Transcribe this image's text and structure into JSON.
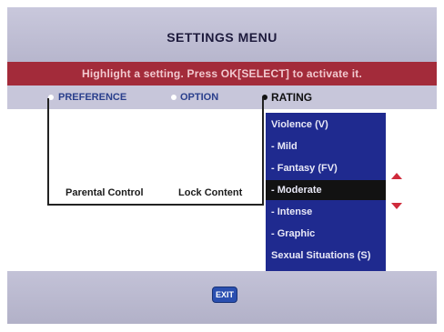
{
  "title": "SETTINGS MENU",
  "banner": "Highlight a setting. Press OK[SELECT] to activate it.",
  "tabs": [
    {
      "label": "PREFERENCE"
    },
    {
      "label": "OPTION"
    },
    {
      "label": "RATING"
    }
  ],
  "labels": {
    "parental": "Parental Control",
    "lock": "Lock Content"
  },
  "rating_list": [
    {
      "label": "Violence (V)",
      "selected": false
    },
    {
      "label": "- Mild",
      "selected": false
    },
    {
      "label": "- Fantasy (FV)",
      "selected": false
    },
    {
      "label": "- Moderate",
      "selected": true
    },
    {
      "label": "- Intense",
      "selected": false
    },
    {
      "label": "- Graphic",
      "selected": false
    },
    {
      "label": "Sexual Situations (S)",
      "selected": false
    }
  ],
  "exit_label": "EXIT",
  "colors": {
    "banner": "#a32b3a",
    "list_bg": "#1f2a8f",
    "selected": "#121212",
    "arrows": "#cf2b3b"
  }
}
